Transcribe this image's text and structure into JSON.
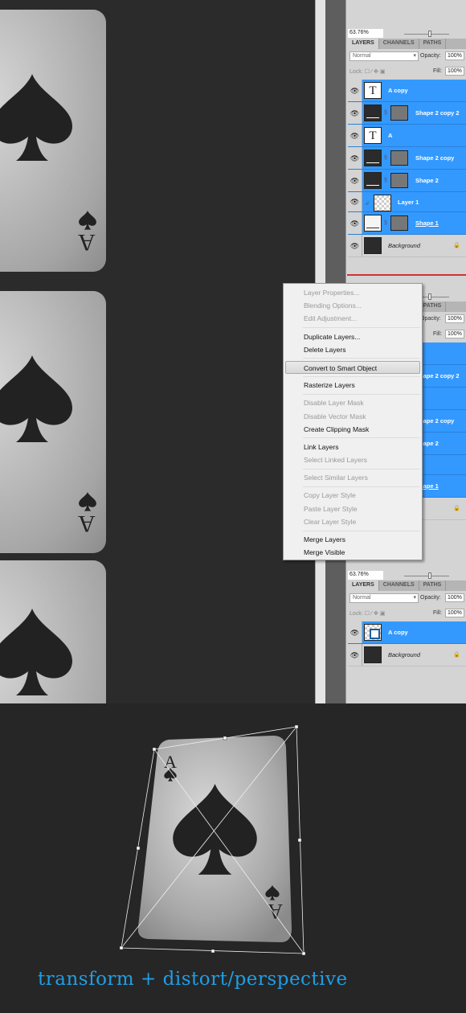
{
  "colors": {
    "selection": "#3399ff",
    "caption": "#1f9ee6",
    "canvas": "#2b2b2b"
  },
  "panel": {
    "zoom": "63.76%",
    "tabs": [
      "LAYERS",
      "CHANNELS",
      "PATHS"
    ],
    "blend_mode": "Normal",
    "opacity_label": "Opacity:",
    "opacity": "100%",
    "lock_label": "Lock:",
    "fill_label": "Fill:",
    "fill": "100%"
  },
  "layers_before": [
    {
      "name": "A copy",
      "thumb": "text",
      "selected": true
    },
    {
      "name": "Shape 2 copy 2",
      "thumb": "shape",
      "mask": true,
      "selected": true
    },
    {
      "name": "A",
      "thumb": "text",
      "selected": true
    },
    {
      "name": "Shape 2 copy",
      "thumb": "shape",
      "mask": true,
      "selected": true
    },
    {
      "name": "Shape 2",
      "thumb": "shape",
      "mask": true,
      "selected": true
    },
    {
      "name": "Layer 1",
      "thumb": "check",
      "clipped": true,
      "selected": true
    },
    {
      "name": "Shape 1",
      "thumb": "white",
      "mask": true,
      "selected": true,
      "underline": true
    },
    {
      "name": "Background",
      "thumb": "bg",
      "locked": true,
      "selected": false
    }
  ],
  "layers_after": [
    {
      "name": "A copy",
      "thumb": "smart",
      "selected": true
    },
    {
      "name": "Background",
      "thumb": "bg",
      "locked": true,
      "selected": false
    }
  ],
  "context_menu": [
    [
      {
        "label": "Layer Properties...",
        "enabled": false
      },
      {
        "label": "Blending Options...",
        "enabled": false
      },
      {
        "label": "Edit Adjustment...",
        "enabled": false
      }
    ],
    [
      {
        "label": "Duplicate Layers...",
        "enabled": true
      },
      {
        "label": "Delete Layers",
        "enabled": true
      }
    ],
    [
      {
        "label": "Convert to Smart Object",
        "enabled": true,
        "highlighted": true
      }
    ],
    [
      {
        "label": "Rasterize Layers",
        "enabled": true
      }
    ],
    [
      {
        "label": "Disable Layer Mask",
        "enabled": false
      },
      {
        "label": "Disable Vector Mask",
        "enabled": false
      },
      {
        "label": "Create Clipping Mask",
        "enabled": true
      }
    ],
    [
      {
        "label": "Link Layers",
        "enabled": true
      },
      {
        "label": "Select Linked Layers",
        "enabled": false
      }
    ],
    [
      {
        "label": "Select Similar Layers",
        "enabled": false
      }
    ],
    [
      {
        "label": "Copy Layer Style",
        "enabled": false
      },
      {
        "label": "Paste Layer Style",
        "enabled": false
      },
      {
        "label": "Clear Layer Style",
        "enabled": false
      }
    ],
    [
      {
        "label": "Merge Layers",
        "enabled": true
      },
      {
        "label": "Merge Visible",
        "enabled": true
      }
    ]
  ],
  "card": {
    "rank": "A",
    "suit": "spade"
  },
  "caption": "transform + distort/perspective"
}
